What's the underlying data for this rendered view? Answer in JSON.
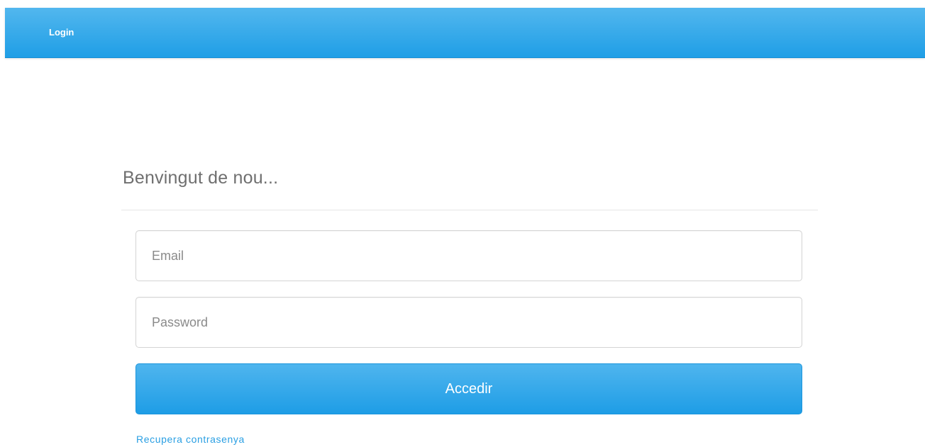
{
  "navbar": {
    "brand": "Login"
  },
  "login_panel": {
    "heading": "Benvingut de nou...",
    "email": {
      "value": "",
      "placeholder": "Email"
    },
    "password": {
      "value": "",
      "placeholder": "Password"
    },
    "submit_label": "Accedir",
    "recover_link": "Recupera contrasenya"
  },
  "colors": {
    "accent": "#22a0e6",
    "link": "#2a9fe3",
    "heading": "#6f6f6f"
  }
}
